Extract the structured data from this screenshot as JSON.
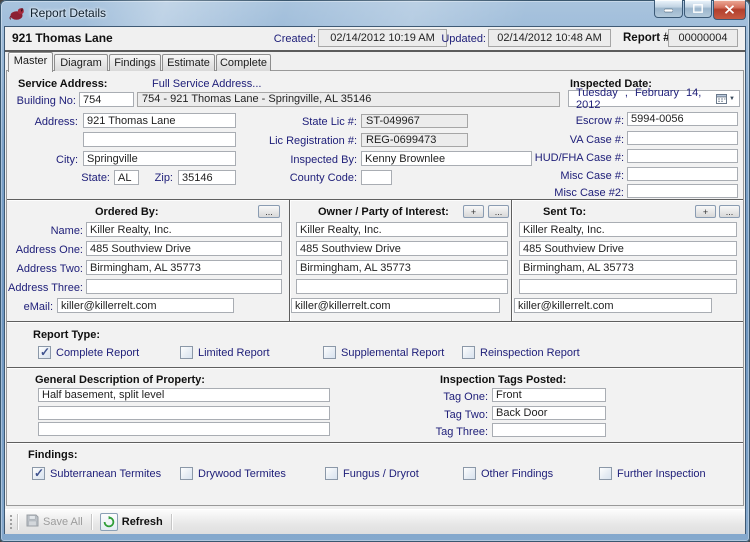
{
  "window": {
    "title": "Report Details"
  },
  "header": {
    "title": "921 Thomas Lane",
    "created_label": "Created:",
    "created_value": "02/14/2012 10:19 AM",
    "updated_label": "Updated:",
    "updated_value": "02/14/2012 10:48 AM",
    "report_label": "Report #",
    "report_value": "00000004"
  },
  "tabs": {
    "master": "Master",
    "diagram": "Diagram",
    "findings": "Findings",
    "estimate": "Estimate",
    "complete": "Complete"
  },
  "service_address": {
    "section_label": "Service Address:",
    "full_address_link": "Full Service Address...",
    "building_no_label": "Building No:",
    "building_no": "754",
    "full_address": "754 - 921 Thomas Lane - Springville, AL 35146",
    "address_label": "Address:",
    "address1": "921 Thomas Lane",
    "address2": "",
    "city_label": "City:",
    "city": "Springville",
    "state_label": "State:",
    "state": "AL",
    "zip_label": "Zip:",
    "zip": "35146"
  },
  "license": {
    "state_lic_label": "State Lic #:",
    "state_lic": "ST-049967",
    "lic_reg_label": "Lic Registration #:",
    "lic_reg": "REG-0699473",
    "inspected_by_label": "Inspected By:",
    "inspected_by": "Kenny Brownlee",
    "county_code_label": "County Code:",
    "county_code": ""
  },
  "inspected_date": {
    "section_label": "Inspected Date:",
    "value": "Tuesday , February 14, 2012"
  },
  "case_numbers": {
    "escrow_label": "Escrow #:",
    "escrow": "5994-0056",
    "va_label": "VA Case #:",
    "va": "",
    "hud_label": "HUD/FHA Case #:",
    "hud": "",
    "misc_label": "Misc Case #:",
    "misc": "",
    "misc2_label": "Misc Case #2:",
    "misc2": ""
  },
  "ordered_by": {
    "section_label": "Ordered By:",
    "name_label": "Name:",
    "name": "Killer Realty, Inc.",
    "address_one_label": "Address One:",
    "address_one": "485 Southview Drive",
    "address_two_label": "Address Two:",
    "address_two": "Birmingham, AL 35773",
    "address_three_label": "Address Three:",
    "address_three": "",
    "email_label": "eMail:",
    "email": "killer@killerrelt.com"
  },
  "owner": {
    "section_label": "Owner / Party of Interest:",
    "name": "Killer Realty, Inc.",
    "address_one": "485 Southview Drive",
    "address_two": "Birmingham, AL 35773",
    "address_three": "",
    "email": "killer@killerrelt.com"
  },
  "sent_to": {
    "section_label": "Sent To:",
    "name": "Killer Realty, Inc.",
    "address_one": "485 Southview Drive",
    "address_two": "Birmingham, AL 35773",
    "address_three": "",
    "email": "killer@killerrelt.com"
  },
  "report_type": {
    "section_label": "Report Type:",
    "options": [
      {
        "label": "Complete Report",
        "checked": true
      },
      {
        "label": "Limited Report",
        "checked": false
      },
      {
        "label": "Supplemental Report",
        "checked": false
      },
      {
        "label": "Reinspection Report",
        "checked": false
      }
    ]
  },
  "general_description": {
    "section_label": "General Description of Property:",
    "line1": "Half basement, split level",
    "line2": "",
    "line3": ""
  },
  "inspection_tags": {
    "section_label": "Inspection Tags Posted:",
    "tag_one_label": "Tag One:",
    "tag_one": "Front",
    "tag_two_label": "Tag Two:",
    "tag_two": "Back Door",
    "tag_three_label": "Tag Three:",
    "tag_three": ""
  },
  "findings": {
    "section_label": "Findings:",
    "options": [
      {
        "label": "Subterranean Termites",
        "checked": true
      },
      {
        "label": "Drywood Termites",
        "checked": false
      },
      {
        "label": "Fungus / Dryrot",
        "checked": false
      },
      {
        "label": "Other Findings",
        "checked": false
      },
      {
        "label": "Further Inspection",
        "checked": false
      }
    ]
  },
  "toolbar": {
    "save_all": "Save All",
    "refresh": "Refresh"
  },
  "ui": {
    "ellipsis_button": "...",
    "add_button": "+"
  },
  "colors": {
    "titlebar_blue": "#7ca2c9",
    "close_red": "#c65a43",
    "label_navy": "#20207a",
    "refresh_green": "#2f9e38"
  }
}
